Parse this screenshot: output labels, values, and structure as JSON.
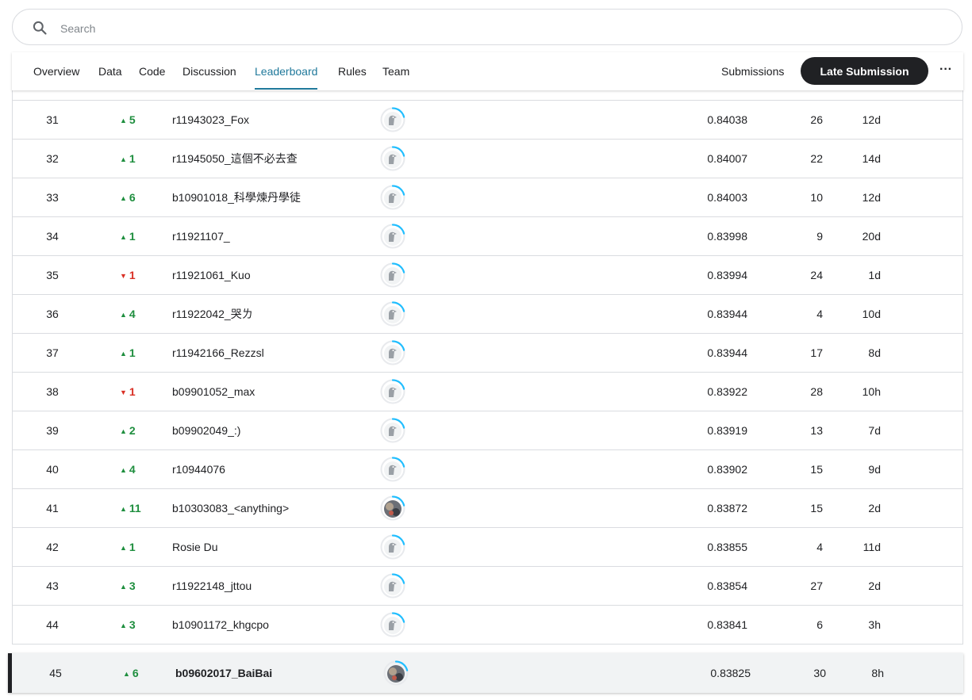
{
  "search": {
    "placeholder": "Search"
  },
  "nav": {
    "tabs": [
      "Overview",
      "Data",
      "Code",
      "Discussion",
      "Leaderboard",
      "Rules",
      "Team"
    ],
    "active_tab": "Leaderboard",
    "submissions_label": "Submissions",
    "late_submission_label": "Late Submission",
    "more_label": "···"
  },
  "colors": {
    "accent": "#20799b",
    "up": "#1e8e3e",
    "down": "#d93025",
    "ring": "#20beff"
  },
  "rows": [
    {
      "rank": "31",
      "dir": "up",
      "move": "5",
      "team": "r11943023_Fox",
      "avatar": "default-avatar",
      "score": "0.84038",
      "entries": "26",
      "last": "12d"
    },
    {
      "rank": "32",
      "dir": "up",
      "move": "1",
      "team": "r11945050_這個不必去查",
      "avatar": "default-avatar",
      "score": "0.84007",
      "entries": "22",
      "last": "14d"
    },
    {
      "rank": "33",
      "dir": "up",
      "move": "6",
      "team": "b10901018_科學煉丹學徒",
      "avatar": "default-avatar",
      "score": "0.84003",
      "entries": "10",
      "last": "12d"
    },
    {
      "rank": "34",
      "dir": "up",
      "move": "1",
      "team": "r11921107_",
      "avatar": "default-avatar",
      "score": "0.83998",
      "entries": "9",
      "last": "20d"
    },
    {
      "rank": "35",
      "dir": "down",
      "move": "1",
      "team": "r11921061_Kuo",
      "avatar": "default-avatar",
      "score": "0.83994",
      "entries": "24",
      "last": "1d"
    },
    {
      "rank": "36",
      "dir": "up",
      "move": "4",
      "team": "r11922042_哭ㄌ",
      "avatar": "default-avatar",
      "score": "0.83944",
      "entries": "4",
      "last": "10d"
    },
    {
      "rank": "37",
      "dir": "up",
      "move": "1",
      "team": "r11942166_Rezzsl",
      "avatar": "default-avatar",
      "score": "0.83944",
      "entries": "17",
      "last": "8d"
    },
    {
      "rank": "38",
      "dir": "down",
      "move": "1",
      "team": "b09901052_max",
      "avatar": "default-avatar",
      "score": "0.83922",
      "entries": "28",
      "last": "10h"
    },
    {
      "rank": "39",
      "dir": "up",
      "move": "2",
      "team": "b09902049_:)",
      "avatar": "default-avatar",
      "score": "0.83919",
      "entries": "13",
      "last": "7d"
    },
    {
      "rank": "40",
      "dir": "up",
      "move": "4",
      "team": "r10944076",
      "avatar": "default-avatar",
      "score": "0.83902",
      "entries": "15",
      "last": "9d"
    },
    {
      "rank": "41",
      "dir": "up",
      "move": "11",
      "team": "b10303083_<anything>",
      "avatar": "photo-avatar",
      "score": "0.83872",
      "entries": "15",
      "last": "2d"
    },
    {
      "rank": "42",
      "dir": "up",
      "move": "1",
      "team": "Rosie Du",
      "avatar": "default-avatar",
      "score": "0.83855",
      "entries": "4",
      "last": "11d"
    },
    {
      "rank": "43",
      "dir": "up",
      "move": "3",
      "team": "r11922148_jttou",
      "avatar": "default-avatar",
      "score": "0.83854",
      "entries": "27",
      "last": "2d"
    },
    {
      "rank": "44",
      "dir": "up",
      "move": "3",
      "team": "b10901172_khgcpo",
      "avatar": "default-avatar",
      "score": "0.83841",
      "entries": "6",
      "last": "3h"
    }
  ],
  "self_row": {
    "rank": "45",
    "dir": "up",
    "move": "6",
    "team": "b09602017_BaiBai",
    "avatar": "photo-avatar",
    "score": "0.83825",
    "entries": "30",
    "last": "8h"
  }
}
